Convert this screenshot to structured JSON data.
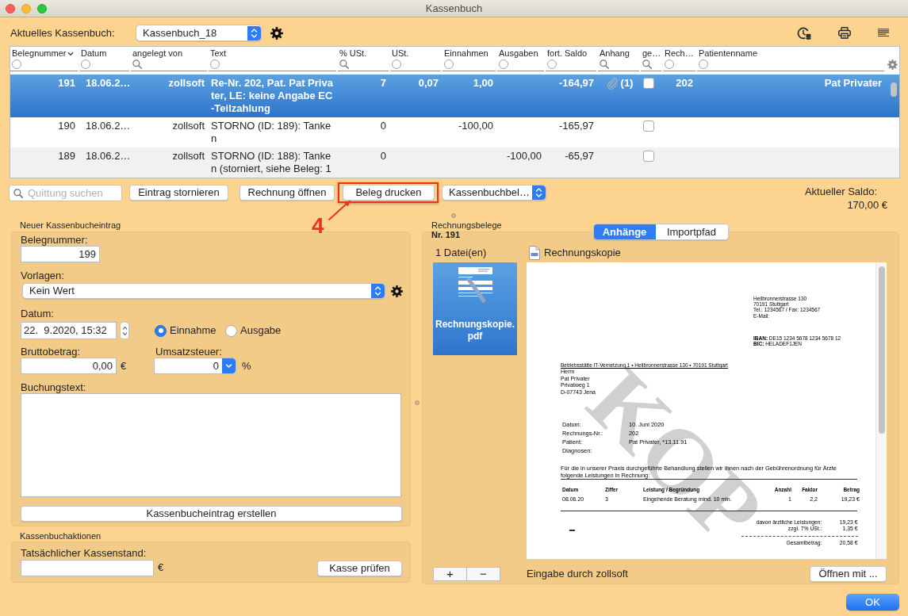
{
  "window": {
    "title": "Kassenbuch"
  },
  "header": {
    "label": "Aktuelles Kassenbuch:",
    "cashbook": "Kassenbuch_18"
  },
  "table": {
    "columns": [
      {
        "label": "Belegnummer",
        "sorted": true,
        "kind": "circle"
      },
      {
        "label": "Datum",
        "sorted": false,
        "kind": "circle"
      },
      {
        "label": "angelegt von",
        "sorted": false,
        "kind": "search"
      },
      {
        "label": "Text",
        "sorted": false,
        "kind": "circle"
      },
      {
        "label": "% USt.",
        "sorted": false,
        "kind": "search"
      },
      {
        "label": "USt.",
        "sorted": false,
        "kind": "circle"
      },
      {
        "label": "Einnahmen",
        "sorted": false,
        "kind": "circle"
      },
      {
        "label": "Ausgaben",
        "sorted": false,
        "kind": "circle"
      },
      {
        "label": "fort. Saldo",
        "sorted": false,
        "kind": "circle"
      },
      {
        "label": "Anhang",
        "sorted": false,
        "kind": "search"
      },
      {
        "label": "ge…",
        "sorted": false,
        "kind": "search"
      },
      {
        "label": "Rech…",
        "sorted": false,
        "kind": "circle"
      },
      {
        "label": "Patientenname",
        "sorted": false,
        "kind": "circle"
      }
    ],
    "rows": [
      {
        "selected": true,
        "belegnummer": "191",
        "datum": "18.06.2…",
        "angelegt_von": "zollsoft",
        "text": "Re-Nr. 202, Pat. Pat Privater, LE: keine Angabe EC-Teilzahlung",
        "ust_prozent": "7",
        "ust": "0,07",
        "einnahmen": "1,00",
        "saldo": "-164,97",
        "anhang": "(1)",
        "checked": false,
        "rechnung": "202",
        "patient": "Pat Privater"
      },
      {
        "selected": false,
        "belegnummer": "190",
        "datum": "18.06.2…",
        "angelegt_von": "zollsoft",
        "text": "STORNO (ID: 189): Tanken",
        "ust_prozent": "0",
        "einnahmen": "-100,00",
        "saldo": "-165,97",
        "checked": false
      },
      {
        "selected": false,
        "belegnummer": "189",
        "datum": "18.06.2…",
        "angelegt_von": "zollsoft",
        "text": "STORNO (ID: 188): Tanken (storniert, siehe Beleg: 1",
        "ust_prozent": "0",
        "ausgaben": "-100,00",
        "saldo": "-65,97",
        "checked": false
      }
    ]
  },
  "toolbar": {
    "search_placeholder": "Quittung suchen",
    "buttons": [
      {
        "label": "Eintrag stornieren",
        "highlighted": false
      },
      {
        "label": "Rechnung öffnen",
        "highlighted": false
      },
      {
        "label": "Beleg drucken",
        "highlighted": true
      }
    ],
    "export": "Kassenbuchbel…",
    "balance_label": "Aktueller Saldo:",
    "balance": "170,00 €"
  },
  "annotation": {
    "label": "4"
  },
  "new_entry": {
    "title": "Neuer Kassenbucheintrag",
    "number": {
      "label": "Belegnummer:",
      "value": "199"
    },
    "template": {
      "label": "Vorlagen:",
      "value": "Kein Wert"
    },
    "date": {
      "label": "Datum:",
      "value": "22.  9.2020, 15:32"
    },
    "type": [
      {
        "label": "Einnahme",
        "selected": true
      },
      {
        "label": "Ausgabe",
        "selected": false
      }
    ],
    "gross": {
      "label": "Bruttobetrag:",
      "value": "0,00",
      "unit": "€"
    },
    "vat": {
      "label": "Umsatzsteuer:",
      "value": "0",
      "unit": "%"
    },
    "text": {
      "label": "Buchungstext:"
    },
    "submit": "Kassenbucheintrag erstellen"
  },
  "actions": {
    "title": "Kassenbuchaktionen",
    "label": "Tatsächlicher Kassenstand:",
    "unit": "€",
    "button": "Kasse prüfen"
  },
  "receipts": {
    "title": "Rechnungsbelege",
    "number": "Nr. 191",
    "tabs": [
      {
        "label": "Anhänge",
        "selected": true
      },
      {
        "label": "Importpfad",
        "selected": false
      }
    ],
    "file_count": "1 Datei(en)",
    "files": [
      {
        "name": "Rechnungskopie.pdf",
        "selected": true
      }
    ],
    "preview_title": "Rechnungskopie",
    "document": {
      "address": [
        "Heilbronnerstrasse 130",
        "70191 Stuttgart",
        "Tel.: 1234567 / Fax: 1234567",
        "E-Mail:"
      ],
      "bank": [
        "**IBAN:** DE15 1234 5678 1234 5678 12",
        "**BIC:** HELADEF1JEN"
      ],
      "return_address": "Betriebsstätte IT-Vernetzung 1 • Heilbronnerstrasse 130 • 70191 Stuttgart",
      "recipient": [
        "Herrn",
        "Pat Privater",
        "Privatweg 1",
        "D-07743 Jena"
      ],
      "info": [
        {
          "label": "Datum:",
          "value": "10. Juni 2020"
        },
        {
          "label": "Rechnungs-Nr.:",
          "value": "202"
        },
        {
          "label": "Patient:",
          "value": "Pat Privater, *13.11.91"
        },
        {
          "label": "Diagnosen:"
        }
      ],
      "intro": "Für die in unserer Praxis durchgeführte Behandlung stellen wir Ihnen nach der Gebührenordnung für Ärzte folgende Leistungen in Rechnung:",
      "item_columns": [
        "Datum",
        "Ziffer",
        "Leistung / Begründung",
        "Anzahl",
        "Faktor",
        "Betrag"
      ],
      "items": [
        [
          "08.06.20",
          "3",
          "Eingehende Beratung mind. 10 min.",
          "1",
          "2,2",
          "19,23 €"
        ]
      ],
      "totals": [
        {
          "label": "davon ärztliche Leistungen:",
          "value": "19,23 €",
          "kind": "line"
        },
        {
          "label": "zzgl. 7% USt.:",
          "value": "1,35 €",
          "kind": "line"
        },
        {
          "label": "Gesamtbetrag:",
          "value": "20,58 €",
          "kind": "sum"
        }
      ],
      "watermark": "KOP"
    },
    "add": "+",
    "remove": "−",
    "entered_by": "Eingabe durch zollsoft",
    "open_with": "Öffnen mit ..."
  },
  "ok_button": "OK"
}
